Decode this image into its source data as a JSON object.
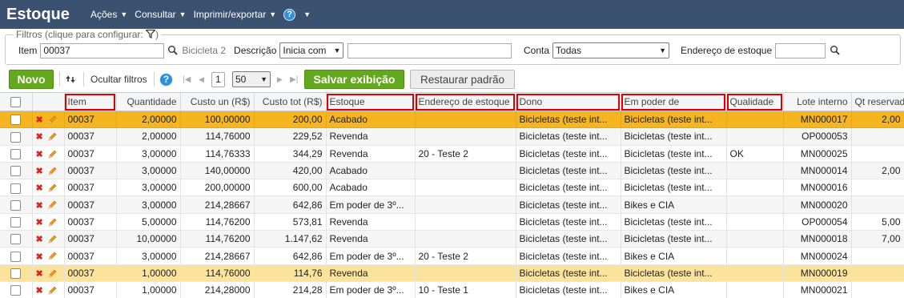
{
  "app": {
    "title": "Estoque"
  },
  "menu": {
    "acoes": "Ações",
    "consultar": "Consultar",
    "imprimir": "Imprimir/exportar",
    "help": "?"
  },
  "filters": {
    "legend": "Filtros (clique para configurar:",
    "item_label": "Item",
    "item_value": "00037",
    "item_desc": "Bicicleta 2",
    "descricao_label": "Descrição",
    "descricao_mode": "Inicia com",
    "descricao_value": "",
    "conta_label": "Conta",
    "conta_value": "Todas",
    "endereco_label": "Endereço de estoque",
    "endereco_value": ""
  },
  "toolbar": {
    "novo": "Novo",
    "ocultar": "Ocultar filtros",
    "help": "?",
    "page": "1",
    "page_size": "50",
    "salvar": "Salvar exibição",
    "restaurar": "Restaurar padrão"
  },
  "table": {
    "headers": [
      "Item",
      "Quantidade",
      "Custo un (R$)",
      "Custo tot (R$)",
      "Estoque",
      "Endereço de estoque",
      "Dono",
      "Em poder de",
      "Qualidade",
      "Lote interno",
      "Qt reservada"
    ],
    "rows": [
      [
        "00037",
        "2,00000",
        "100,00000",
        "200,00",
        "Acabado",
        "",
        "Bicicletas (teste int...",
        "Bicicletas (teste int...",
        "",
        "MN000017",
        "2,00"
      ],
      [
        "00037",
        "2,00000",
        "114,76000",
        "229,52",
        "Revenda",
        "",
        "Bicicletas (teste int...",
        "Bicicletas (teste int...",
        "",
        "OP000053",
        ""
      ],
      [
        "00037",
        "3,00000",
        "114,76333",
        "344,29",
        "Revenda",
        "20 - Teste 2",
        "Bicicletas (teste int...",
        "Bicicletas (teste int...",
        "OK",
        "MN000025",
        ""
      ],
      [
        "00037",
        "3,00000",
        "140,00000",
        "420,00",
        "Acabado",
        "",
        "Bicicletas (teste int...",
        "Bicicletas (teste int...",
        "",
        "MN000014",
        "2,00"
      ],
      [
        "00037",
        "3,00000",
        "200,00000",
        "600,00",
        "Acabado",
        "",
        "Bicicletas (teste int...",
        "Bicicletas (teste int...",
        "",
        "MN000016",
        ""
      ],
      [
        "00037",
        "3,00000",
        "214,28667",
        "642,86",
        "Em poder de 3º...",
        "",
        "Bicicletas (teste int...",
        "Bikes e CIA",
        "",
        "MN000020",
        ""
      ],
      [
        "00037",
        "5,00000",
        "114,76200",
        "573,81",
        "Revenda",
        "",
        "Bicicletas (teste int...",
        "Bicicletas (teste int...",
        "",
        "OP000054",
        "5,00"
      ],
      [
        "00037",
        "10,00000",
        "114,76200",
        "1.147,62",
        "Revenda",
        "",
        "Bicicletas (teste int...",
        "Bicicletas (teste int...",
        "",
        "MN000018",
        "7,00"
      ],
      [
        "00037",
        "3,00000",
        "214,28667",
        "642,86",
        "Em poder de 3º...",
        "20 - Teste 2",
        "Bicicletas (teste int...",
        "Bikes e CIA",
        "",
        "MN000024",
        ""
      ],
      [
        "00037",
        "1,00000",
        "114,76000",
        "114,76",
        "Revenda",
        "",
        "Bicicletas (teste int...",
        "Bicicletas (teste int...",
        "",
        "MN000019",
        ""
      ],
      [
        "00037",
        "1,00000",
        "214,28000",
        "214,28",
        "Em poder de 3º...",
        "10 - Teste 1",
        "Bicicletas (teste int...",
        "Bikes e CIA",
        "",
        "MN000021",
        ""
      ]
    ]
  },
  "colors": {
    "titlebar": "#3b5170",
    "accent_green": "#63a81d",
    "row_selected": "#f5b520",
    "row_hover": "#fbe39c",
    "highlight_box": "#e00000"
  }
}
